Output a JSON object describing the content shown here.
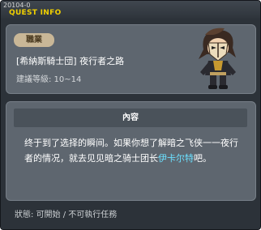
{
  "window": {
    "id_label": "20104-0",
    "title": "QUEST INFO"
  },
  "quest": {
    "tag": "職業",
    "name": "[希納斯騎士団] 夜行者之路",
    "level": "建議等級: 10~14",
    "portrait_icon": "masked-knight-portrait-icon"
  },
  "content": {
    "header": "內容",
    "text_before": "终于到了选择的瞬间。如果你想了解暗之飞侠一一夜行者的情况，就去见见暗之骑士团长",
    "npc_name": "伊卡尔特",
    "text_after": "吧。",
    "npc_color": "#6be0ff"
  },
  "status": "狀態: 可開始 / 不可執行任務",
  "colors": {
    "title": "#f0d000",
    "panel": "#5e666f",
    "window": "#2c3239"
  }
}
